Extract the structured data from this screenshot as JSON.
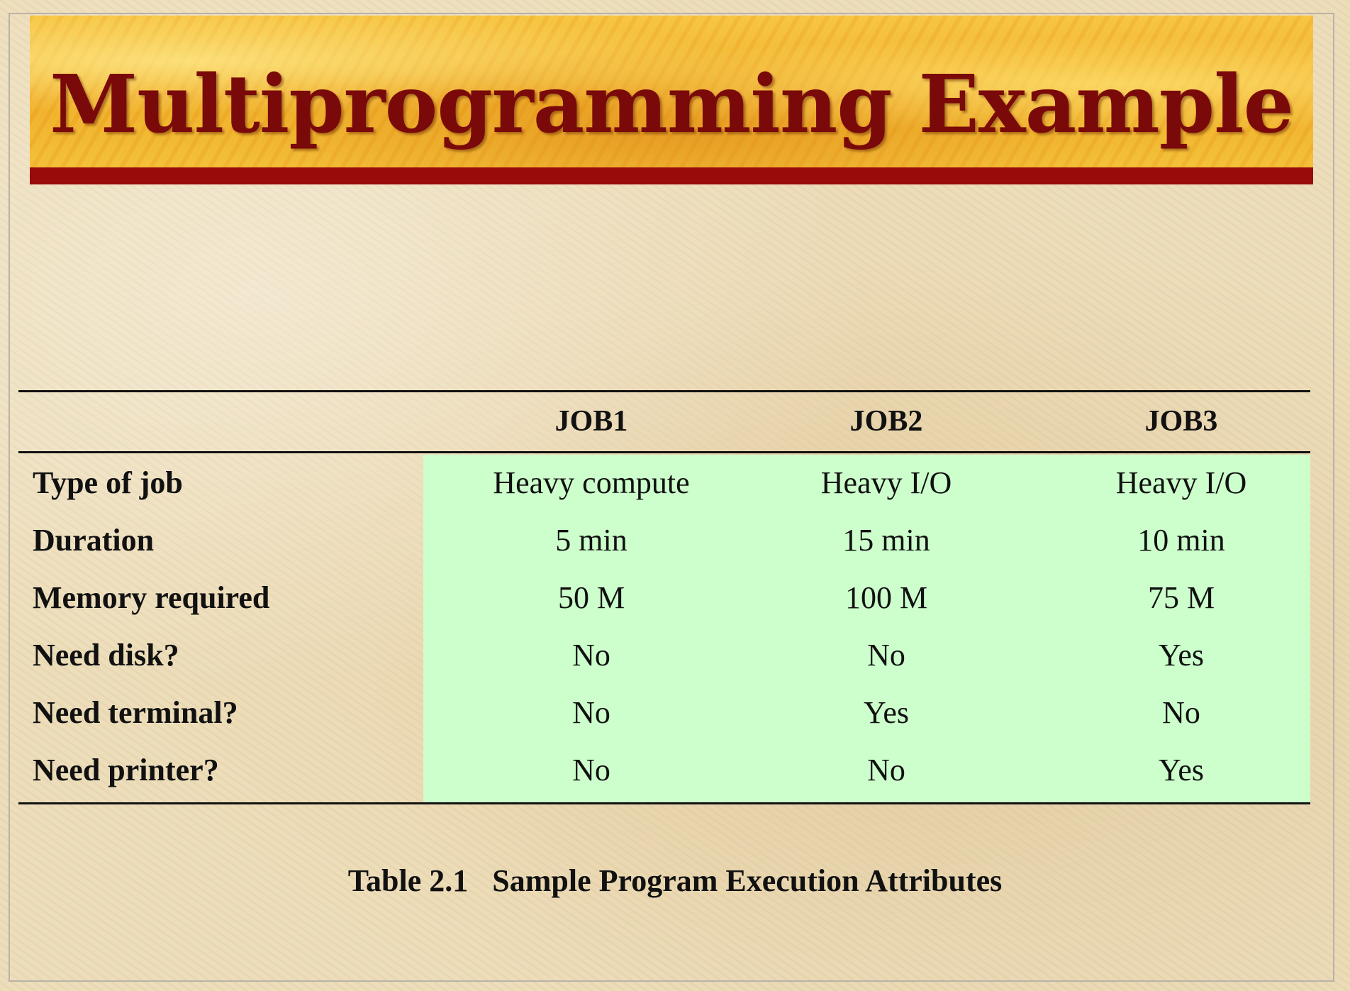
{
  "slide": {
    "title": "Multiprogramming Example"
  },
  "table": {
    "columns": [
      "JOB1",
      "JOB2",
      "JOB3"
    ],
    "rows": [
      {
        "label": "Type of job",
        "values": [
          "Heavy compute",
          "Heavy I/O",
          "Heavy I/O"
        ]
      },
      {
        "label": "Duration",
        "values": [
          "5 min",
          "15 min",
          "10 min"
        ]
      },
      {
        "label": "Memory required",
        "values": [
          "50 M",
          "100 M",
          "75 M"
        ]
      },
      {
        "label": "Need disk?",
        "values": [
          "No",
          "No",
          "Yes"
        ]
      },
      {
        "label": "Need terminal?",
        "values": [
          "No",
          "Yes",
          "No"
        ]
      },
      {
        "label": "Need printer?",
        "values": [
          "No",
          "No",
          "Yes"
        ]
      }
    ],
    "caption_number": "Table 2.1",
    "caption_text": "Sample Program Execution Attributes"
  },
  "colors": {
    "title": "#7a0a0a",
    "title_rule": "#990a0a",
    "highlight": "#ccffcc"
  }
}
